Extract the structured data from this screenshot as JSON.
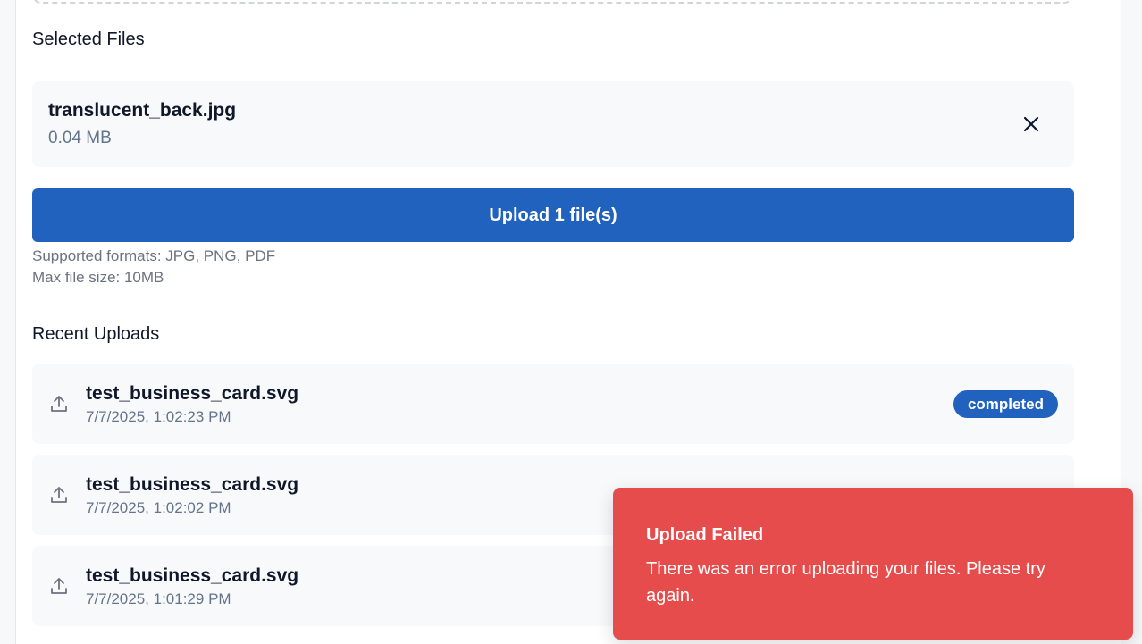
{
  "selected": {
    "title": "Selected Files",
    "file": {
      "name": "translucent_back.jpg",
      "size": "0.04 MB",
      "remove_icon": "close-icon"
    }
  },
  "upload_button": {
    "label": "Upload 1 file(s)",
    "color": "#2162be"
  },
  "hints": {
    "formats": "Supported formats: JPG, PNG, PDF",
    "max_size": "Max file size: 10MB"
  },
  "recent": {
    "title": "Recent Uploads",
    "items": [
      {
        "name": "test_business_card.svg",
        "time": "7/7/2025, 1:02:23 PM",
        "status": "completed",
        "icon": "upload-icon"
      },
      {
        "name": "test_business_card.svg",
        "time": "7/7/2025, 1:02:02 PM",
        "icon": "upload-icon"
      },
      {
        "name": "test_business_card.svg",
        "time": "7/7/2025, 1:01:29 PM",
        "icon": "upload-icon"
      }
    ]
  },
  "toast": {
    "title": "Upload Failed",
    "message": "There was an error uploading your files. Please try again.",
    "color": "#e74c4c"
  }
}
